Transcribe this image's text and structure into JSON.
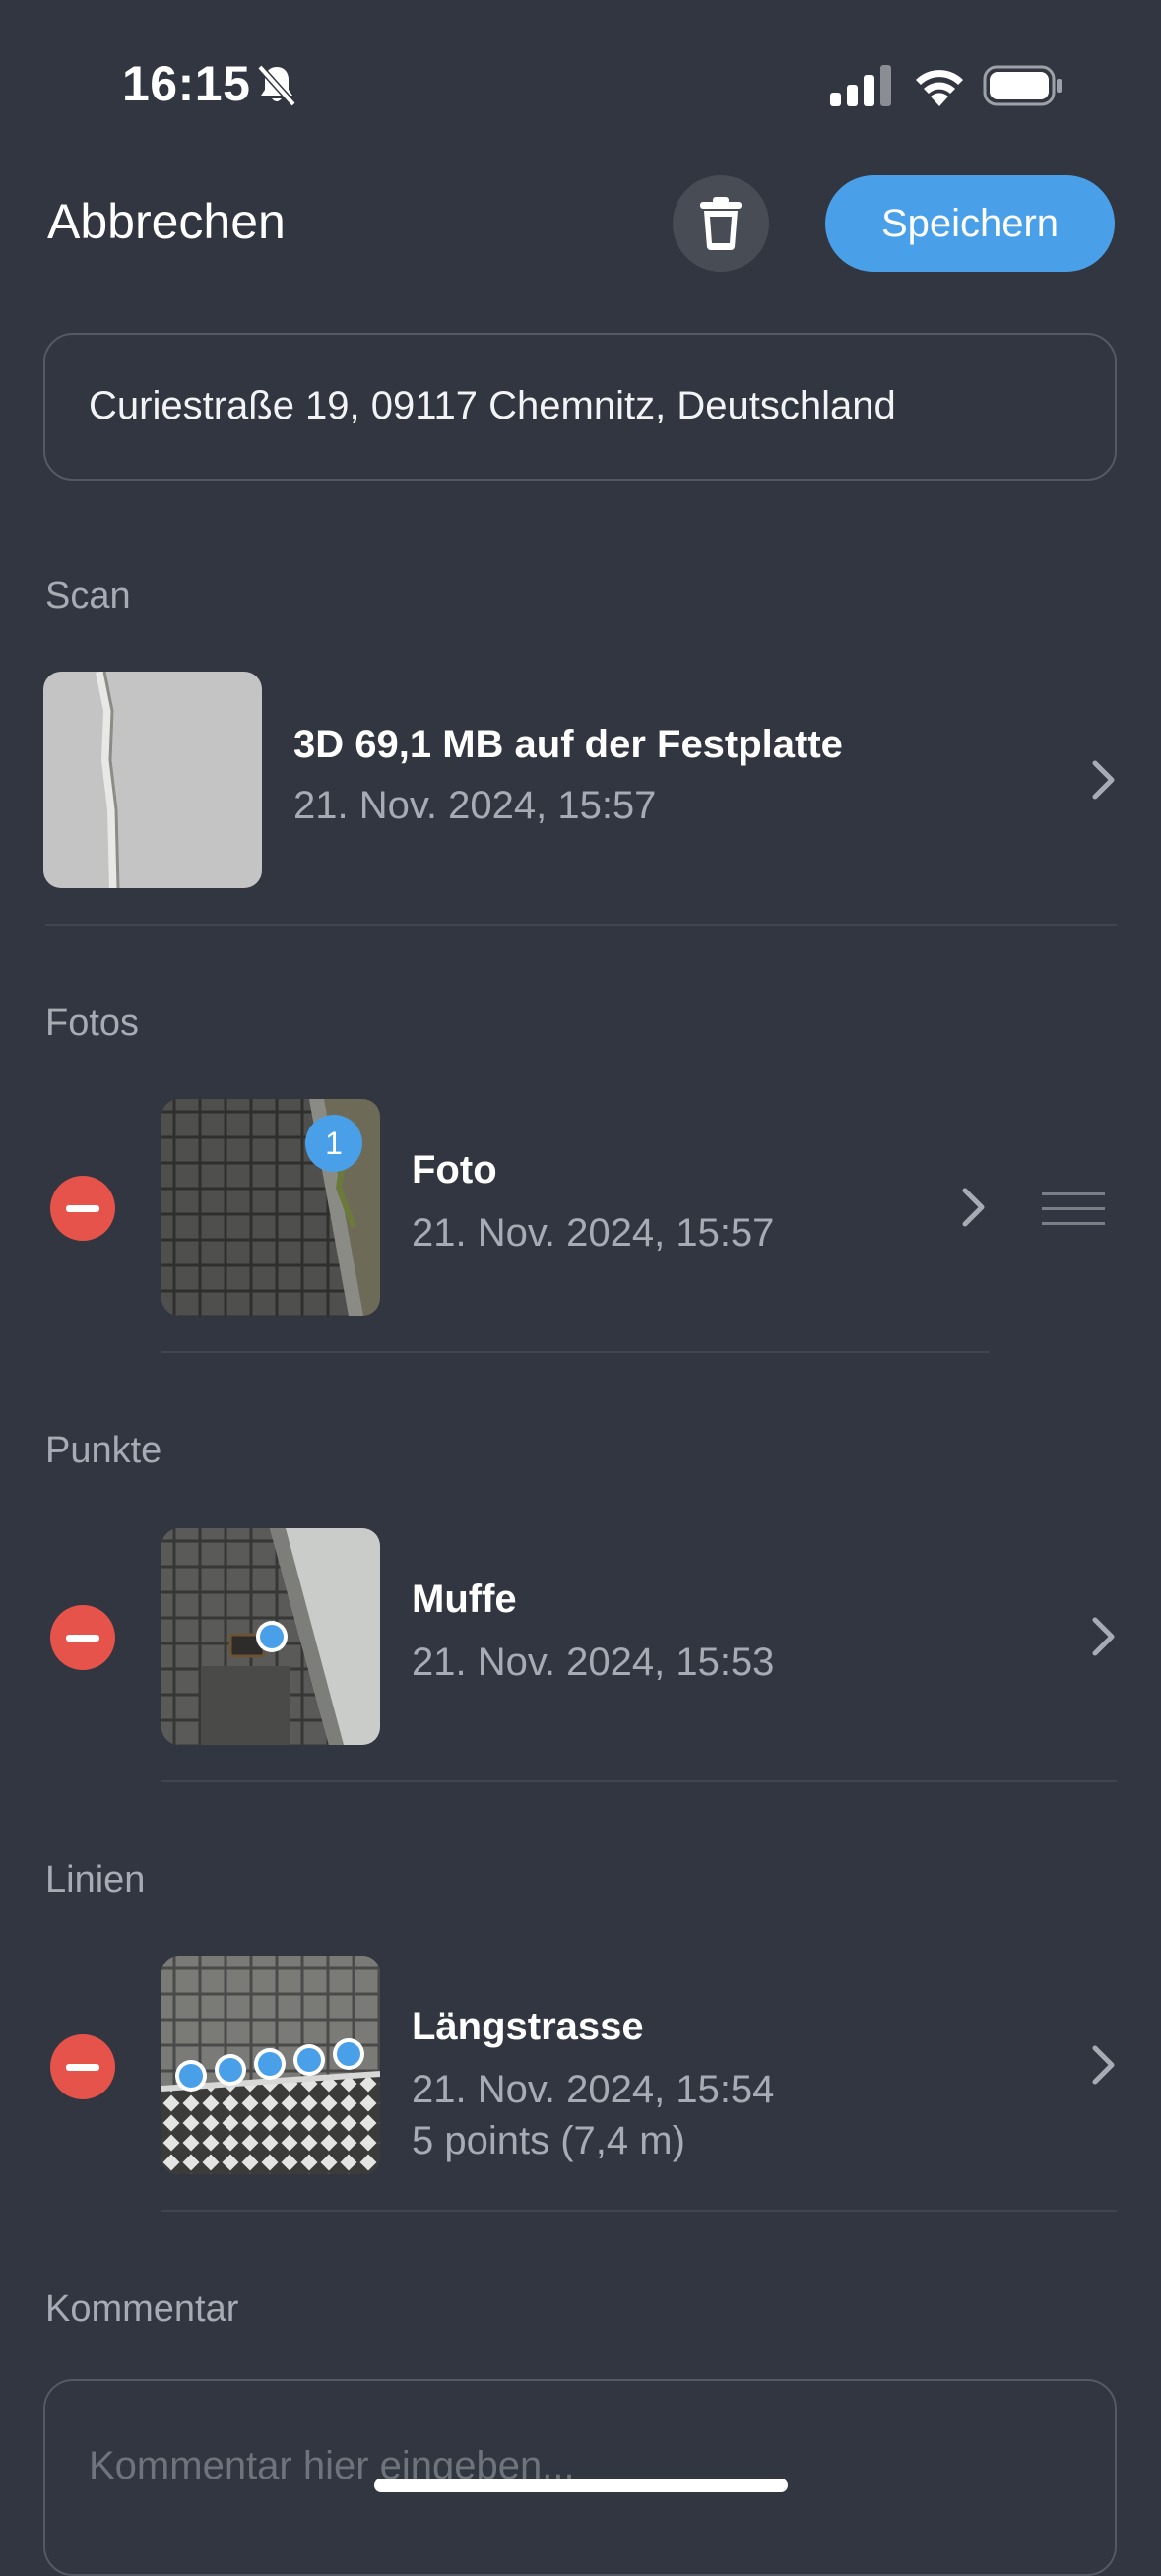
{
  "status_bar": {
    "time": "16:15"
  },
  "header": {
    "cancel_label": "Abbrechen",
    "save_label": "Speichern"
  },
  "address": "Curiestraße 19, 09117 Chemnitz, Deutschland",
  "sections": {
    "scan": {
      "title": "Scan",
      "item": {
        "title": "3D 69,1 MB auf der Festplatte",
        "date": "21. Nov. 2024, 15:57"
      }
    },
    "photos": {
      "title": "Fotos",
      "item": {
        "badge": "1",
        "title": "Foto",
        "date": "21. Nov. 2024, 15:57"
      }
    },
    "points": {
      "title": "Punkte",
      "item": {
        "title": "Muffe",
        "date": "21. Nov. 2024, 15:53"
      }
    },
    "lines": {
      "title": "Linien",
      "item": {
        "title": "Längstrasse",
        "date": "21. Nov. 2024, 15:54",
        "detail": "5 points (7,4 m)"
      }
    },
    "comment": {
      "title": "Kommentar",
      "placeholder": "Kommentar hier eingeben..."
    }
  },
  "colors": {
    "background": "#313640",
    "accent": "#4aa0e8",
    "destructive": "#e5534b",
    "secondary_text": "#a7abb3"
  }
}
